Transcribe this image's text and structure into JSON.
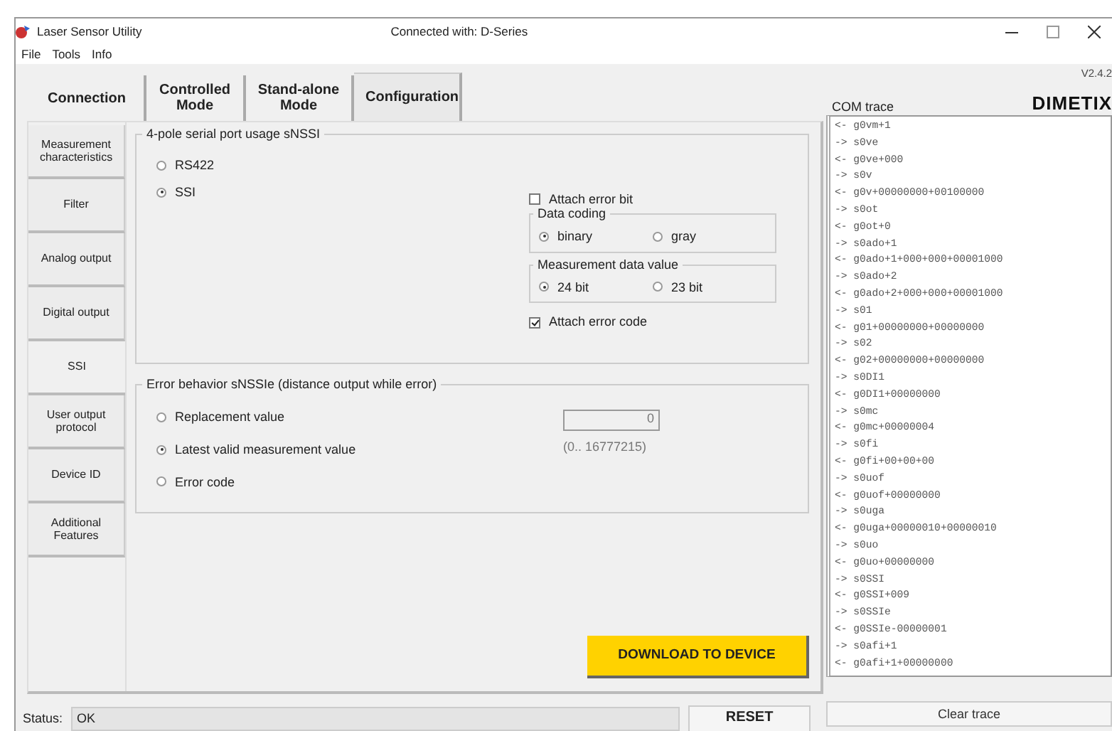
{
  "window": {
    "title": "Laser Sensor Utility",
    "connection": "Connected with: D-Series"
  },
  "menu": [
    {
      "label": "File"
    },
    {
      "label": "Tools"
    },
    {
      "label": "Info"
    }
  ],
  "tabs": [
    {
      "label": "Connection",
      "selected": false
    },
    {
      "label": "Controlled Mode",
      "selected": false
    },
    {
      "label": "Stand-alone Mode",
      "selected": false
    },
    {
      "label": "Configuration",
      "selected": true
    }
  ],
  "side_tabs": [
    {
      "label": "Measurement characteristics",
      "selected": false
    },
    {
      "label": "Filter",
      "selected": false
    },
    {
      "label": "Analog output",
      "selected": false
    },
    {
      "label": "Digital output",
      "selected": false
    },
    {
      "label": "SSI",
      "selected": true
    },
    {
      "label": "User output protocol",
      "selected": false
    },
    {
      "label": "Device ID",
      "selected": false
    },
    {
      "label": "Additional Features",
      "selected": false
    }
  ],
  "serial_port_group": {
    "title": "4-pole serial port usage sNSSI",
    "options": [
      {
        "label": "RS422",
        "selected": false
      },
      {
        "label": "SSI",
        "selected": true
      }
    ],
    "attach_error_bit": {
      "label": "Attach error bit",
      "checked": false
    },
    "data_coding": {
      "title": "Data coding",
      "options": [
        {
          "label": "binary",
          "selected": true
        },
        {
          "label": "gray",
          "selected": false
        }
      ]
    },
    "measurement_data_value": {
      "title": "Measurement data value",
      "options": [
        {
          "label": "24 bit",
          "selected": true
        },
        {
          "label": "23 bit",
          "selected": false
        }
      ]
    },
    "attach_error_code": {
      "label": "Attach error code",
      "checked": true
    }
  },
  "error_behavior_group": {
    "title": "Error behavior sNSSIe (distance output while error)",
    "options": [
      {
        "label": "Replacement value",
        "selected": false
      },
      {
        "label": "Latest valid measurement value",
        "selected": true
      },
      {
        "label": "Error code",
        "selected": false
      }
    ],
    "replacement_value": {
      "value": "0",
      "range": "(0.. 16777215)"
    }
  },
  "download_button": "DOWNLOAD TO DEVICE",
  "status": {
    "label": "Status:",
    "value": "OK"
  },
  "reset_button": "RESET",
  "version": "V2.4.2",
  "logo": "DIMETIX",
  "com_trace": {
    "title": "COM trace",
    "lines": [
      "<- g0vm+1",
      "-> s0ve",
      "<- g0ve+000",
      "-> s0v",
      "<- g0v+00000000+00100000",
      "-> s0ot",
      "<- g0ot+0",
      "-> s0ado+1",
      "<- g0ado+1+000+000+00001000",
      "-> s0ado+2",
      "<- g0ado+2+000+000+00001000",
      "-> s01",
      "<- g01+00000000+00000000",
      "-> s02",
      "<- g02+00000000+00000000",
      "-> s0DI1",
      "<- g0DI1+00000000",
      "-> s0mc",
      "<- g0mc+00000004",
      "-> s0fi",
      "<- g0fi+00+00+00",
      "-> s0uof",
      "<- g0uof+00000000",
      "-> s0uga",
      "<- g0uga+00000010+00000010",
      "-> s0uo",
      "<- g0uo+00000000",
      "-> s0SSI",
      "<- g0SSI+009",
      "-> s0SSIe",
      "<- g0SSIe-00000001",
      "-> s0afi+1",
      "<- g0afi+1+00000000"
    ]
  },
  "clear_trace_button": "Clear trace"
}
